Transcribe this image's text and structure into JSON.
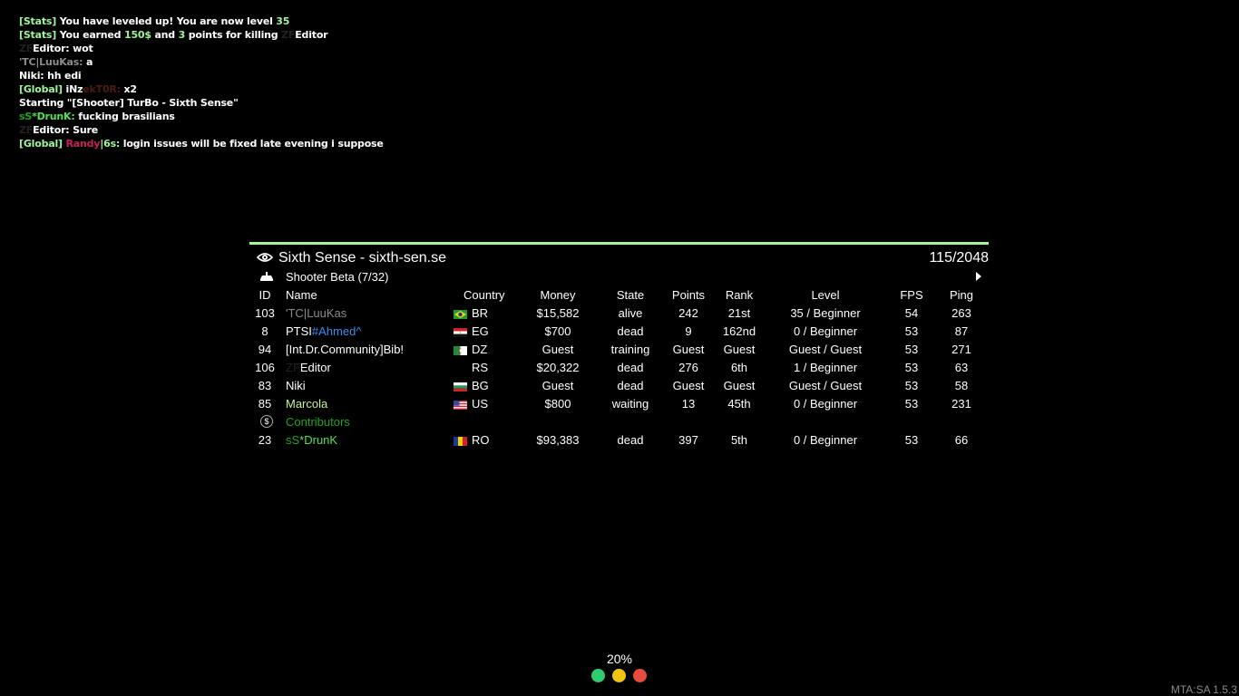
{
  "chat": [
    [
      {
        "t": "[Stats] ",
        "c": "#9ff59a"
      },
      {
        "t": "You have leveled up! You are now level ",
        "c": "#ffffff"
      },
      {
        "t": "35",
        "c": "#9ff59a"
      }
    ],
    [
      {
        "t": "[Stats] ",
        "c": "#9ff59a"
      },
      {
        "t": "You earned ",
        "c": "#ffffff"
      },
      {
        "t": "150$",
        "c": "#9ff59a"
      },
      {
        "t": " and ",
        "c": "#ffffff"
      },
      {
        "t": "3",
        "c": "#9ff59a"
      },
      {
        "t": " points for killing ",
        "c": "#ffffff"
      },
      {
        "t": "ZF",
        "c": "#222222"
      },
      {
        "t": "Editor",
        "c": "#ffffff"
      }
    ],
    [
      {
        "t": "ZF",
        "c": "#222222"
      },
      {
        "t": "Editor: wot",
        "c": "#ffffff"
      }
    ],
    [
      {
        "t": "'TC|LuuKas: ",
        "c": "#8c8c8c"
      },
      {
        "t": "a",
        "c": "#ffffff"
      }
    ],
    [
      {
        "t": "Niki: hh edi",
        "c": "#ffffff"
      }
    ],
    [
      {
        "t": "[Global] ",
        "c": "#9ff59a"
      },
      {
        "t": "iNz",
        "c": "#ffffff"
      },
      {
        "t": "ekT0R: ",
        "c": "#4a1d12"
      },
      {
        "t": "x2",
        "c": "#ffffff"
      }
    ],
    [
      {
        "t": "Starting \"[Shooter] TurBo - Sixth Sense\"",
        "c": "#ffffff"
      }
    ],
    [
      {
        "t": "sS",
        "c": "#1fa51f"
      },
      {
        "t": "*DrunK: ",
        "c": "#55e055"
      },
      {
        "t": "fucking brasilians",
        "c": "#ffffff"
      }
    ],
    [
      {
        "t": "ZF",
        "c": "#222222"
      },
      {
        "t": "Editor: Sure",
        "c": "#ffffff"
      }
    ],
    [
      {
        "t": "[Global] ",
        "c": "#9ff59a"
      },
      {
        "t": "Randy",
        "c": "#c8205a"
      },
      {
        "t": "|6s: ",
        "c": "#9ff59a"
      },
      {
        "t": "login issues will be fixed late evening i suppose",
        "c": "#ffffff"
      }
    ]
  ],
  "scoreboard": {
    "accent": "#a4f59a",
    "server_title": "Sixth Sense - sixth-sen.se",
    "player_count": "115/2048",
    "gamemode": "Shooter Beta (7/32)",
    "headers": {
      "id": "ID",
      "name": "Name",
      "country": "Country",
      "money": "Money",
      "state": "State",
      "points": "Points",
      "rank": "Rank",
      "level": "Level",
      "fps": "FPS",
      "ping": "Ping"
    },
    "players": [
      {
        "id": "103",
        "name": [
          {
            "t": "'TC|LuuKas",
            "c": "#8c8c8c"
          }
        ],
        "flag": "BR",
        "country": "BR",
        "money": "$15,582",
        "state": "alive",
        "points": "242",
        "rank": "21st",
        "level": "35 / Beginner",
        "fps": "54",
        "ping": "263"
      },
      {
        "id": "8",
        "name": [
          {
            "t": "PTSI",
            "c": "#ffffff"
          },
          {
            "t": "#Ahmed^",
            "c": "#3c8cf0"
          }
        ],
        "flag": "EG",
        "country": "EG",
        "money": "$700",
        "state": "dead",
        "points": "9",
        "rank": "162nd",
        "level": "0 / Beginner",
        "fps": "53",
        "ping": "87"
      },
      {
        "id": "94",
        "name": [
          {
            "t": "[Int.Dr.Community]Bib!",
            "c": "#ffffff"
          }
        ],
        "flag": "DZ",
        "country": "DZ",
        "money": "Guest",
        "state": "training",
        "points": "Guest",
        "rank": "Guest",
        "level": "Guest / Guest",
        "fps": "53",
        "ping": "271"
      },
      {
        "id": "106",
        "name": [
          {
            "t": "ZF",
            "c": "#222222"
          },
          {
            "t": "Editor",
            "c": "#ffffff"
          }
        ],
        "flag": "",
        "country": "RS",
        "money": "$20,322",
        "state": "dead",
        "points": "276",
        "rank": "6th",
        "level": "1 / Beginner",
        "fps": "53",
        "ping": "63"
      },
      {
        "id": "83",
        "name": [
          {
            "t": "Niki",
            "c": "#ffffff"
          }
        ],
        "flag": "BG",
        "country": "BG",
        "money": "Guest",
        "state": "dead",
        "points": "Guest",
        "rank": "Guest",
        "level": "Guest / Guest",
        "fps": "53",
        "ping": "58"
      },
      {
        "id": "85",
        "name": [
          {
            "t": "Marcola",
            "c": "#c8f0a0"
          }
        ],
        "flag": "US",
        "country": "US",
        "money": "$800",
        "state": "waiting",
        "points": "13",
        "rank": "45th",
        "level": "0 / Beginner",
        "fps": "53",
        "ping": "231"
      }
    ],
    "team": {
      "name": "Contributors",
      "color": "#1fa51f",
      "icon": "dollar-icon"
    },
    "team_players": [
      {
        "id": "23",
        "name": [
          {
            "t": "sS",
            "c": "#1fa51f"
          },
          {
            "t": "*DrunK",
            "c": "#55e055"
          }
        ],
        "flag": "RO",
        "country": "RO",
        "money": "$93,383",
        "state": "dead",
        "points": "397",
        "rank": "5th",
        "level": "0 / Beginner",
        "fps": "53",
        "ping": "66"
      }
    ]
  },
  "loading": {
    "percent": "20%",
    "dots": [
      "#2ecc71",
      "#f1c40f",
      "#e74c3c"
    ]
  },
  "version": "MTA:SA 1.5.3"
}
